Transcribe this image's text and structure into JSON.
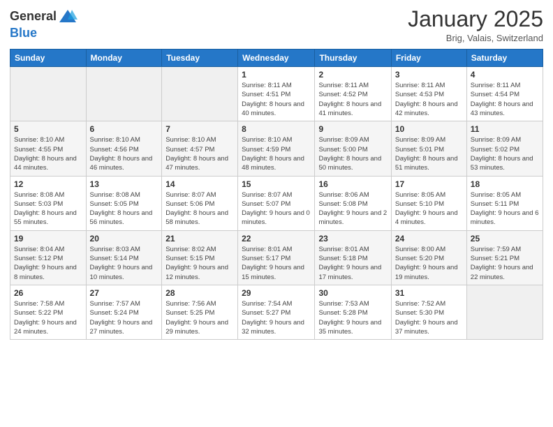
{
  "header": {
    "logo_general": "General",
    "logo_blue": "Blue",
    "title": "January 2025",
    "subtitle": "Brig, Valais, Switzerland"
  },
  "weekdays": [
    "Sunday",
    "Monday",
    "Tuesday",
    "Wednesday",
    "Thursday",
    "Friday",
    "Saturday"
  ],
  "weeks": [
    [
      {
        "day": "",
        "sunrise": "",
        "sunset": "",
        "daylight": ""
      },
      {
        "day": "",
        "sunrise": "",
        "sunset": "",
        "daylight": ""
      },
      {
        "day": "",
        "sunrise": "",
        "sunset": "",
        "daylight": ""
      },
      {
        "day": "1",
        "sunrise": "Sunrise: 8:11 AM",
        "sunset": "Sunset: 4:51 PM",
        "daylight": "Daylight: 8 hours and 40 minutes."
      },
      {
        "day": "2",
        "sunrise": "Sunrise: 8:11 AM",
        "sunset": "Sunset: 4:52 PM",
        "daylight": "Daylight: 8 hours and 41 minutes."
      },
      {
        "day": "3",
        "sunrise": "Sunrise: 8:11 AM",
        "sunset": "Sunset: 4:53 PM",
        "daylight": "Daylight: 8 hours and 42 minutes."
      },
      {
        "day": "4",
        "sunrise": "Sunrise: 8:11 AM",
        "sunset": "Sunset: 4:54 PM",
        "daylight": "Daylight: 8 hours and 43 minutes."
      }
    ],
    [
      {
        "day": "5",
        "sunrise": "Sunrise: 8:10 AM",
        "sunset": "Sunset: 4:55 PM",
        "daylight": "Daylight: 8 hours and 44 minutes."
      },
      {
        "day": "6",
        "sunrise": "Sunrise: 8:10 AM",
        "sunset": "Sunset: 4:56 PM",
        "daylight": "Daylight: 8 hours and 46 minutes."
      },
      {
        "day": "7",
        "sunrise": "Sunrise: 8:10 AM",
        "sunset": "Sunset: 4:57 PM",
        "daylight": "Daylight: 8 hours and 47 minutes."
      },
      {
        "day": "8",
        "sunrise": "Sunrise: 8:10 AM",
        "sunset": "Sunset: 4:59 PM",
        "daylight": "Daylight: 8 hours and 48 minutes."
      },
      {
        "day": "9",
        "sunrise": "Sunrise: 8:09 AM",
        "sunset": "Sunset: 5:00 PM",
        "daylight": "Daylight: 8 hours and 50 minutes."
      },
      {
        "day": "10",
        "sunrise": "Sunrise: 8:09 AM",
        "sunset": "Sunset: 5:01 PM",
        "daylight": "Daylight: 8 hours and 51 minutes."
      },
      {
        "day": "11",
        "sunrise": "Sunrise: 8:09 AM",
        "sunset": "Sunset: 5:02 PM",
        "daylight": "Daylight: 8 hours and 53 minutes."
      }
    ],
    [
      {
        "day": "12",
        "sunrise": "Sunrise: 8:08 AM",
        "sunset": "Sunset: 5:03 PM",
        "daylight": "Daylight: 8 hours and 55 minutes."
      },
      {
        "day": "13",
        "sunrise": "Sunrise: 8:08 AM",
        "sunset": "Sunset: 5:05 PM",
        "daylight": "Daylight: 8 hours and 56 minutes."
      },
      {
        "day": "14",
        "sunrise": "Sunrise: 8:07 AM",
        "sunset": "Sunset: 5:06 PM",
        "daylight": "Daylight: 8 hours and 58 minutes."
      },
      {
        "day": "15",
        "sunrise": "Sunrise: 8:07 AM",
        "sunset": "Sunset: 5:07 PM",
        "daylight": "Daylight: 9 hours and 0 minutes."
      },
      {
        "day": "16",
        "sunrise": "Sunrise: 8:06 AM",
        "sunset": "Sunset: 5:08 PM",
        "daylight": "Daylight: 9 hours and 2 minutes."
      },
      {
        "day": "17",
        "sunrise": "Sunrise: 8:05 AM",
        "sunset": "Sunset: 5:10 PM",
        "daylight": "Daylight: 9 hours and 4 minutes."
      },
      {
        "day": "18",
        "sunrise": "Sunrise: 8:05 AM",
        "sunset": "Sunset: 5:11 PM",
        "daylight": "Daylight: 9 hours and 6 minutes."
      }
    ],
    [
      {
        "day": "19",
        "sunrise": "Sunrise: 8:04 AM",
        "sunset": "Sunset: 5:12 PM",
        "daylight": "Daylight: 9 hours and 8 minutes."
      },
      {
        "day": "20",
        "sunrise": "Sunrise: 8:03 AM",
        "sunset": "Sunset: 5:14 PM",
        "daylight": "Daylight: 9 hours and 10 minutes."
      },
      {
        "day": "21",
        "sunrise": "Sunrise: 8:02 AM",
        "sunset": "Sunset: 5:15 PM",
        "daylight": "Daylight: 9 hours and 12 minutes."
      },
      {
        "day": "22",
        "sunrise": "Sunrise: 8:01 AM",
        "sunset": "Sunset: 5:17 PM",
        "daylight": "Daylight: 9 hours and 15 minutes."
      },
      {
        "day": "23",
        "sunrise": "Sunrise: 8:01 AM",
        "sunset": "Sunset: 5:18 PM",
        "daylight": "Daylight: 9 hours and 17 minutes."
      },
      {
        "day": "24",
        "sunrise": "Sunrise: 8:00 AM",
        "sunset": "Sunset: 5:20 PM",
        "daylight": "Daylight: 9 hours and 19 minutes."
      },
      {
        "day": "25",
        "sunrise": "Sunrise: 7:59 AM",
        "sunset": "Sunset: 5:21 PM",
        "daylight": "Daylight: 9 hours and 22 minutes."
      }
    ],
    [
      {
        "day": "26",
        "sunrise": "Sunrise: 7:58 AM",
        "sunset": "Sunset: 5:22 PM",
        "daylight": "Daylight: 9 hours and 24 minutes."
      },
      {
        "day": "27",
        "sunrise": "Sunrise: 7:57 AM",
        "sunset": "Sunset: 5:24 PM",
        "daylight": "Daylight: 9 hours and 27 minutes."
      },
      {
        "day": "28",
        "sunrise": "Sunrise: 7:56 AM",
        "sunset": "Sunset: 5:25 PM",
        "daylight": "Daylight: 9 hours and 29 minutes."
      },
      {
        "day": "29",
        "sunrise": "Sunrise: 7:54 AM",
        "sunset": "Sunset: 5:27 PM",
        "daylight": "Daylight: 9 hours and 32 minutes."
      },
      {
        "day": "30",
        "sunrise": "Sunrise: 7:53 AM",
        "sunset": "Sunset: 5:28 PM",
        "daylight": "Daylight: 9 hours and 35 minutes."
      },
      {
        "day": "31",
        "sunrise": "Sunrise: 7:52 AM",
        "sunset": "Sunset: 5:30 PM",
        "daylight": "Daylight: 9 hours and 37 minutes."
      },
      {
        "day": "",
        "sunrise": "",
        "sunset": "",
        "daylight": ""
      }
    ]
  ]
}
